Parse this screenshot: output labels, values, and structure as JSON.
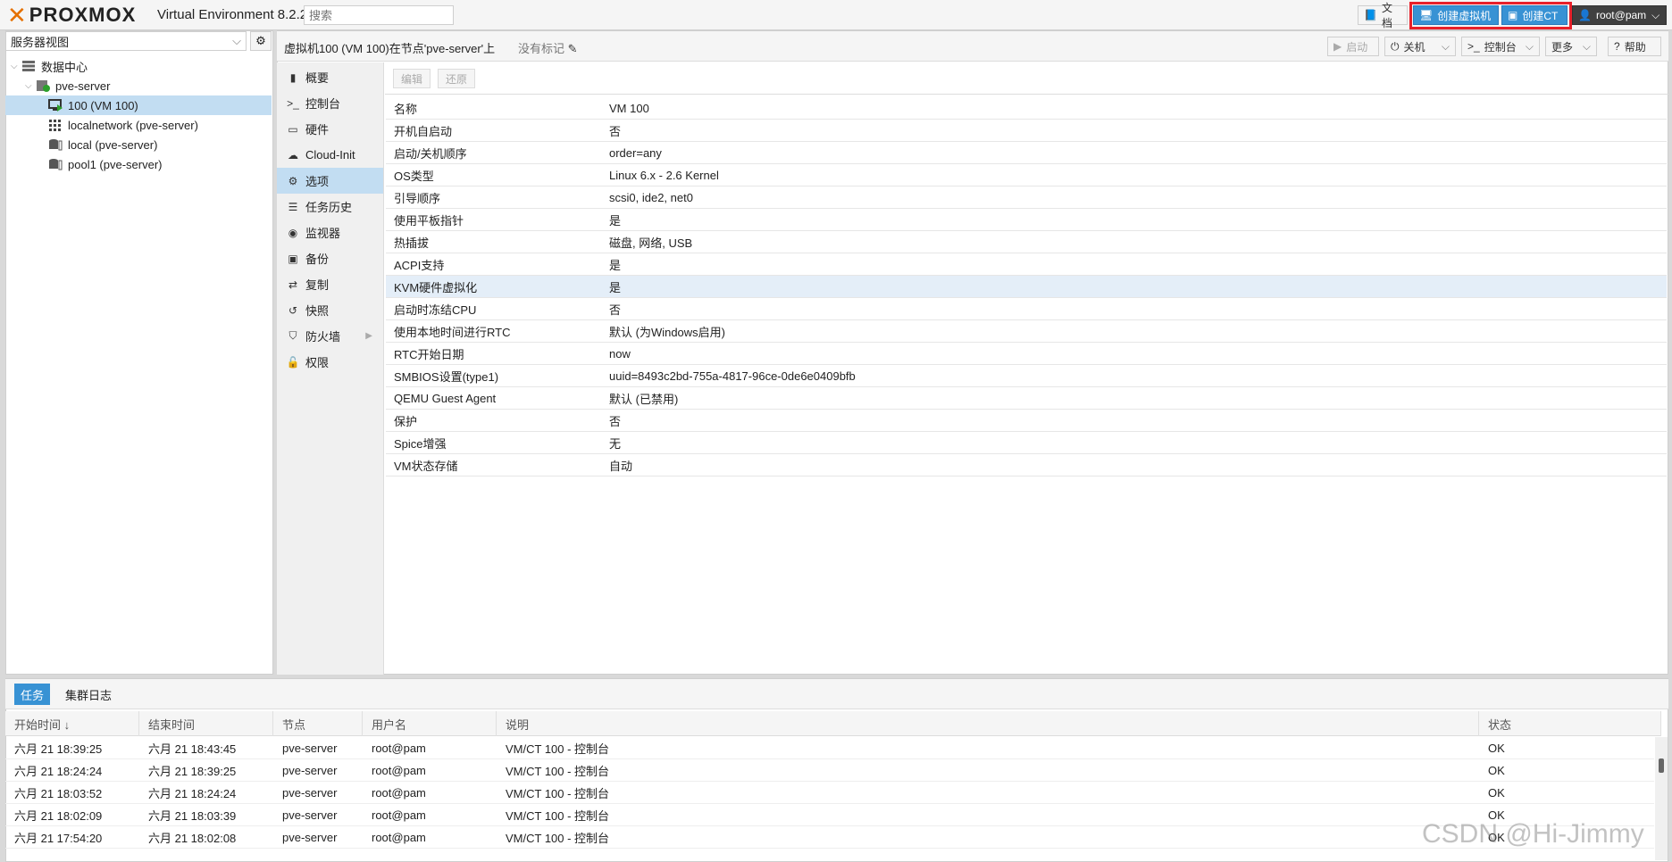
{
  "topbar": {
    "logo_text": "PROXMOX",
    "version": "Virtual Environment 8.2.2",
    "search_placeholder": "搜索",
    "docs_label": "文档",
    "create_vm_label": "创建虚拟机",
    "create_ct_label": "创建CT",
    "user_label": "root@pam"
  },
  "tree": {
    "view_select": "服务器视图",
    "nodes": [
      {
        "label": "数据中心",
        "icon": "datacenter-icon"
      },
      {
        "label": "pve-server",
        "icon": "server-online-icon"
      },
      {
        "label": "100 (VM 100)",
        "icon": "vm-running-icon"
      },
      {
        "label": "localnetwork (pve-server)",
        "icon": "network-grid-icon"
      },
      {
        "label": "local (pve-server)",
        "icon": "storage-icon"
      },
      {
        "label": "pool1 (pve-server)",
        "icon": "storage-icon"
      }
    ]
  },
  "header": {
    "title": "虚拟机100 (VM 100)在节点'pve-server'上",
    "no_tags": "没有标记",
    "start_label": "启动",
    "shutdown_label": "关机",
    "console_label": "控制台",
    "more_label": "更多",
    "help_label": "帮助"
  },
  "subnav": {
    "items": [
      {
        "label": "概要",
        "icon": "book-icon"
      },
      {
        "label": "控制台",
        "icon": "terminal-icon"
      },
      {
        "label": "硬件",
        "icon": "monitor-icon"
      },
      {
        "label": "Cloud-Init",
        "icon": "cloud-icon"
      },
      {
        "label": "选项",
        "icon": "gear-icon"
      },
      {
        "label": "任务历史",
        "icon": "list-icon"
      },
      {
        "label": "监视器",
        "icon": "eye-icon"
      },
      {
        "label": "备份",
        "icon": "floppy-icon"
      },
      {
        "label": "复制",
        "icon": "retweet-icon"
      },
      {
        "label": "快照",
        "icon": "history-icon"
      },
      {
        "label": "防火墙",
        "icon": "shield-icon"
      },
      {
        "label": "权限",
        "icon": "unlock-icon"
      }
    ]
  },
  "options": {
    "edit_label": "编辑",
    "revert_label": "还原",
    "rows": [
      {
        "key": "名称",
        "value": "VM 100"
      },
      {
        "key": "开机自启动",
        "value": "否"
      },
      {
        "key": "启动/关机顺序",
        "value": "order=any"
      },
      {
        "key": "OS类型",
        "value": "Linux 6.x - 2.6 Kernel"
      },
      {
        "key": "引导顺序",
        "value": "scsi0, ide2, net0"
      },
      {
        "key": "使用平板指针",
        "value": "是"
      },
      {
        "key": "热插拔",
        "value": "磁盘, 网络, USB"
      },
      {
        "key": "ACPI支持",
        "value": "是"
      },
      {
        "key": "KVM硬件虚拟化",
        "value": "是"
      },
      {
        "key": "启动时冻结CPU",
        "value": "否"
      },
      {
        "key": "使用本地时间进行RTC",
        "value": "默认 (为Windows启用)"
      },
      {
        "key": "RTC开始日期",
        "value": "now"
      },
      {
        "key": "SMBIOS设置(type1)",
        "value": "uuid=8493c2bd-755a-4817-96ce-0de6e0409bfb"
      },
      {
        "key": "QEMU Guest Agent",
        "value": "默认 (已禁用)"
      },
      {
        "key": "保护",
        "value": "否"
      },
      {
        "key": "Spice增强",
        "value": "无"
      },
      {
        "key": "VM状态存储",
        "value": "自动"
      }
    ]
  },
  "bottom": {
    "tab_tasks": "任务",
    "tab_cluster_log": "集群日志",
    "columns": [
      "开始时间 ↓",
      "结束时间",
      "节点",
      "用户名",
      "说明",
      "状态"
    ],
    "rows": [
      [
        "六月 21 18:39:25",
        "六月 21 18:43:45",
        "pve-server",
        "root@pam",
        "VM/CT 100 - 控制台",
        "OK"
      ],
      [
        "六月 21 18:24:24",
        "六月 21 18:39:25",
        "pve-server",
        "root@pam",
        "VM/CT 100 - 控制台",
        "OK"
      ],
      [
        "六月 21 18:03:52",
        "六月 21 18:24:24",
        "pve-server",
        "root@pam",
        "VM/CT 100 - 控制台",
        "OK"
      ],
      [
        "六月 21 18:02:09",
        "六月 21 18:03:39",
        "pve-server",
        "root@pam",
        "VM/CT 100 - 控制台",
        "OK"
      ],
      [
        "六月 21 17:54:20",
        "六月 21 18:02:08",
        "pve-server",
        "root@pam",
        "VM/CT 100 - 控制台",
        "OK"
      ]
    ]
  },
  "watermark": "CSDN @Hi-Jimmy",
  "colors": {
    "accent": "#3892d4",
    "brand_orange": "#e57000",
    "highlight": "#e8202a",
    "selection": "#c2ddf2"
  }
}
